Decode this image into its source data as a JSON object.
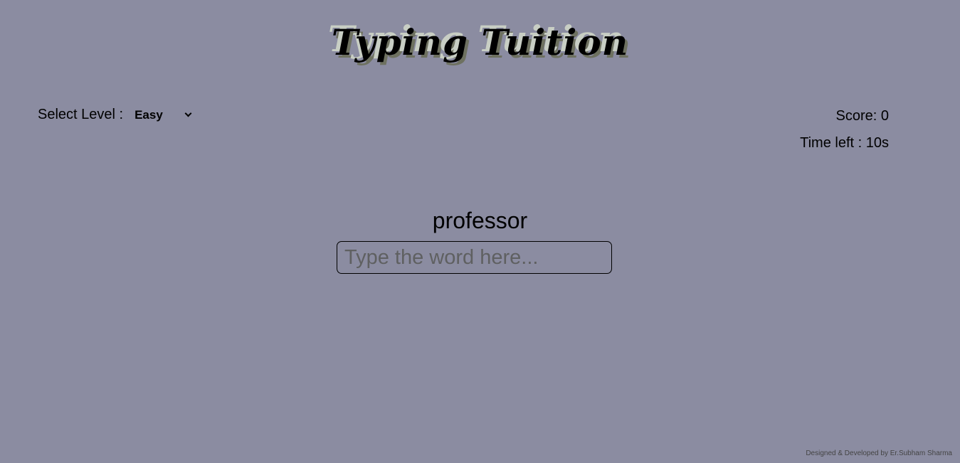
{
  "header": {
    "title": "Typing Tuition"
  },
  "level": {
    "label": "Select Level :",
    "selected": "Easy"
  },
  "stats": {
    "score_text": "Score: 0",
    "time_text": "Time left : 10s"
  },
  "game": {
    "current_word": "professor",
    "input_value": "",
    "input_placeholder": "Type the word here..."
  },
  "footer": {
    "credit": "Designed & Developed by Er.Subham Sharma"
  },
  "colors": {
    "background": "#8b8ca1"
  }
}
